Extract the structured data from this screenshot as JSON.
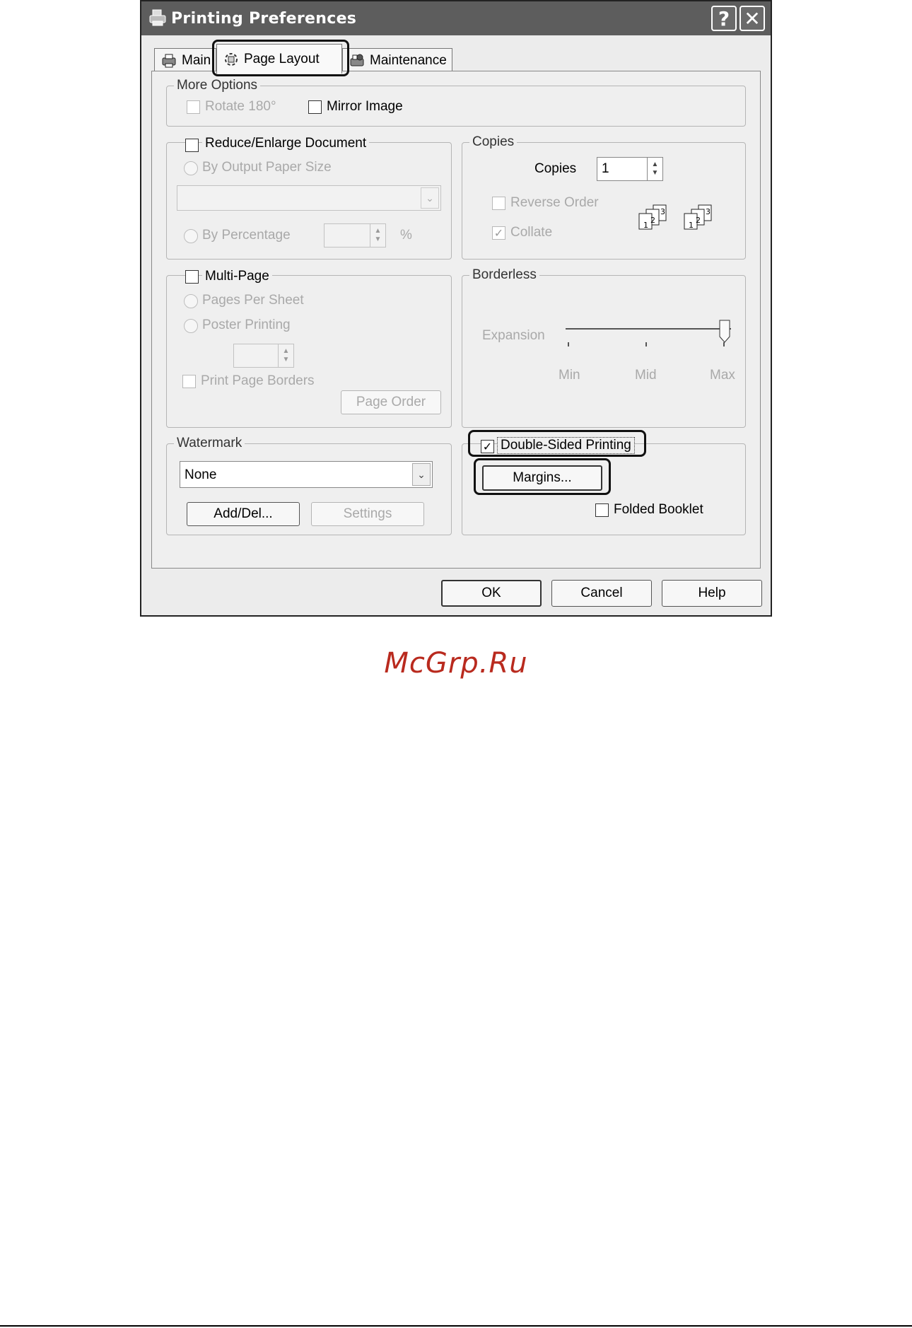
{
  "window": {
    "title": "Printing Preferences",
    "help_glyph": "?",
    "close_glyph": "✕"
  },
  "tabs": [
    {
      "label": "Main",
      "active": false
    },
    {
      "label": "Page Layout",
      "active": true
    },
    {
      "label": "Maintenance",
      "active": false
    }
  ],
  "more_options": {
    "group_label": "More Options",
    "rotate_label": "Rotate 180°",
    "mirror_label": "Mirror Image"
  },
  "reduce_enlarge": {
    "checkbox_label": "Reduce/Enlarge Document",
    "by_output_label": "By Output Paper Size",
    "paper_size_value": "",
    "by_percentage_label": "By Percentage",
    "percent_value": "",
    "percent_unit": "%"
  },
  "copies": {
    "group_label": "Copies",
    "copies_label": "Copies",
    "copies_value": "1",
    "reverse_order_label": "Reverse Order",
    "collate_label": "Collate",
    "collate_checked": true,
    "stack_icon_1": "collate-stack-icon",
    "stack_icon_2": "reverse-stack-icon"
  },
  "multi_page": {
    "checkbox_label": "Multi-Page",
    "pages_per_sheet_label": "Pages Per Sheet",
    "poster_printing_label": "Poster Printing",
    "spinner_value": "",
    "print_page_borders_label": "Print Page Borders",
    "page_order_button": "Page Order"
  },
  "borderless": {
    "group_label": "Borderless",
    "expansion_label": "Expansion",
    "min_label": "Min",
    "mid_label": "Mid",
    "max_label": "Max",
    "slider_position": "Max"
  },
  "watermark": {
    "group_label": "Watermark",
    "selected": "None",
    "add_del_button": "Add/Del...",
    "settings_button": "Settings"
  },
  "double_sided": {
    "checkbox_label": "Double-Sided Printing",
    "checked": true,
    "margins_button": "Margins...",
    "folded_booklet_label": "Folded Booklet",
    "folded_booklet_checked": false
  },
  "footer": {
    "ok": "OK",
    "cancel": "Cancel",
    "help": "Help"
  },
  "page_watermark": "McGrp.Ru",
  "colors": {
    "titlebar": "#5d5d5d",
    "watermark_text": "#b92a1e",
    "highlight_outline": "#111111"
  }
}
